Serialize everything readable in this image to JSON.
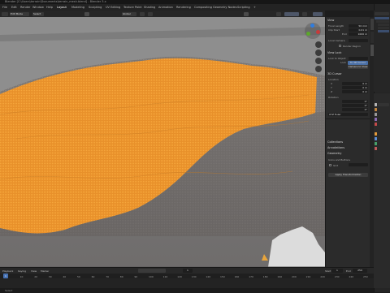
{
  "window": {
    "title": "Blender [C:\\Users\\terrain\\Documents\\terrain_mesh.blend] - Blender 3.x"
  },
  "menubar": {
    "items": [
      "File",
      "Edit",
      "Render",
      "Window",
      "Help",
      "Layout",
      "Modeling",
      "Sculpting",
      "UV Editing",
      "Texture Paint",
      "Shading",
      "Animation",
      "Rendering",
      "Compositing",
      "Geometry Nodes",
      "Scripting",
      "+"
    ]
  },
  "toolbar": {
    "mode_label": "Edit Mode",
    "view_label": "Global",
    "select_label": "Select"
  },
  "npanel": {
    "view_header": "View",
    "focal_label": "Focal Length",
    "focal_value": "50 mm",
    "clip_start_label": "Clip Start",
    "clip_start_value": "0.01 m",
    "clip_end_label": "End",
    "clip_end_value": "1000 m",
    "local_camera_label": "Local Camera",
    "render_region_label": "Render Region",
    "view_lock_header": "View Lock",
    "lock_object_label": "Lock to Object",
    "lock_label": "Lock",
    "to_3d_cursor_label": "To 3D Cursor",
    "camera_to_view_label": "Camera to View",
    "cursor_header": "3D Cursor",
    "location_label": "Location",
    "x_label": "X",
    "x_value": "0 m",
    "y_label": "Y",
    "y_value": "0 m",
    "z_label": "Z",
    "z_value": "0 m",
    "rotation_label": "Rotation",
    "rx_value": "0°",
    "ry_value": "0°",
    "rz_value": "0°",
    "rotation_mode_value": "XYZ Euler",
    "collections_header": "Collections",
    "annotations_header": "Annotations",
    "geometry_header": "Geometry",
    "icons_header": "Icons and Buttons",
    "grid_label": "Grid",
    "apply_label": "Apply Transformation"
  },
  "outliner": {
    "items": [
      "Scene Collection",
      "Collection",
      "Camera",
      "Light",
      "Terrain"
    ]
  },
  "timeline": {
    "playback_label": "Playback",
    "keying_label": "Keying",
    "view_label": "View",
    "marker_label": "Marker",
    "start_label": "Start",
    "start_value": "1",
    "end_label": "End",
    "end_value": "250",
    "current_frame": "1",
    "ruler": [
      "0",
      "10",
      "20",
      "30",
      "40",
      "50",
      "60",
      "70",
      "80",
      "90",
      "100",
      "110",
      "120",
      "130",
      "140",
      "150",
      "160",
      "170",
      "180",
      "190",
      "200",
      "210",
      "220",
      "230",
      "240",
      "250"
    ]
  },
  "statusbar": {
    "text": "Select"
  },
  "colors": {
    "selection_orange": "#f29a2e",
    "mesh_gray": "#7d7d7d",
    "background_gray": "#8c8c8c"
  }
}
